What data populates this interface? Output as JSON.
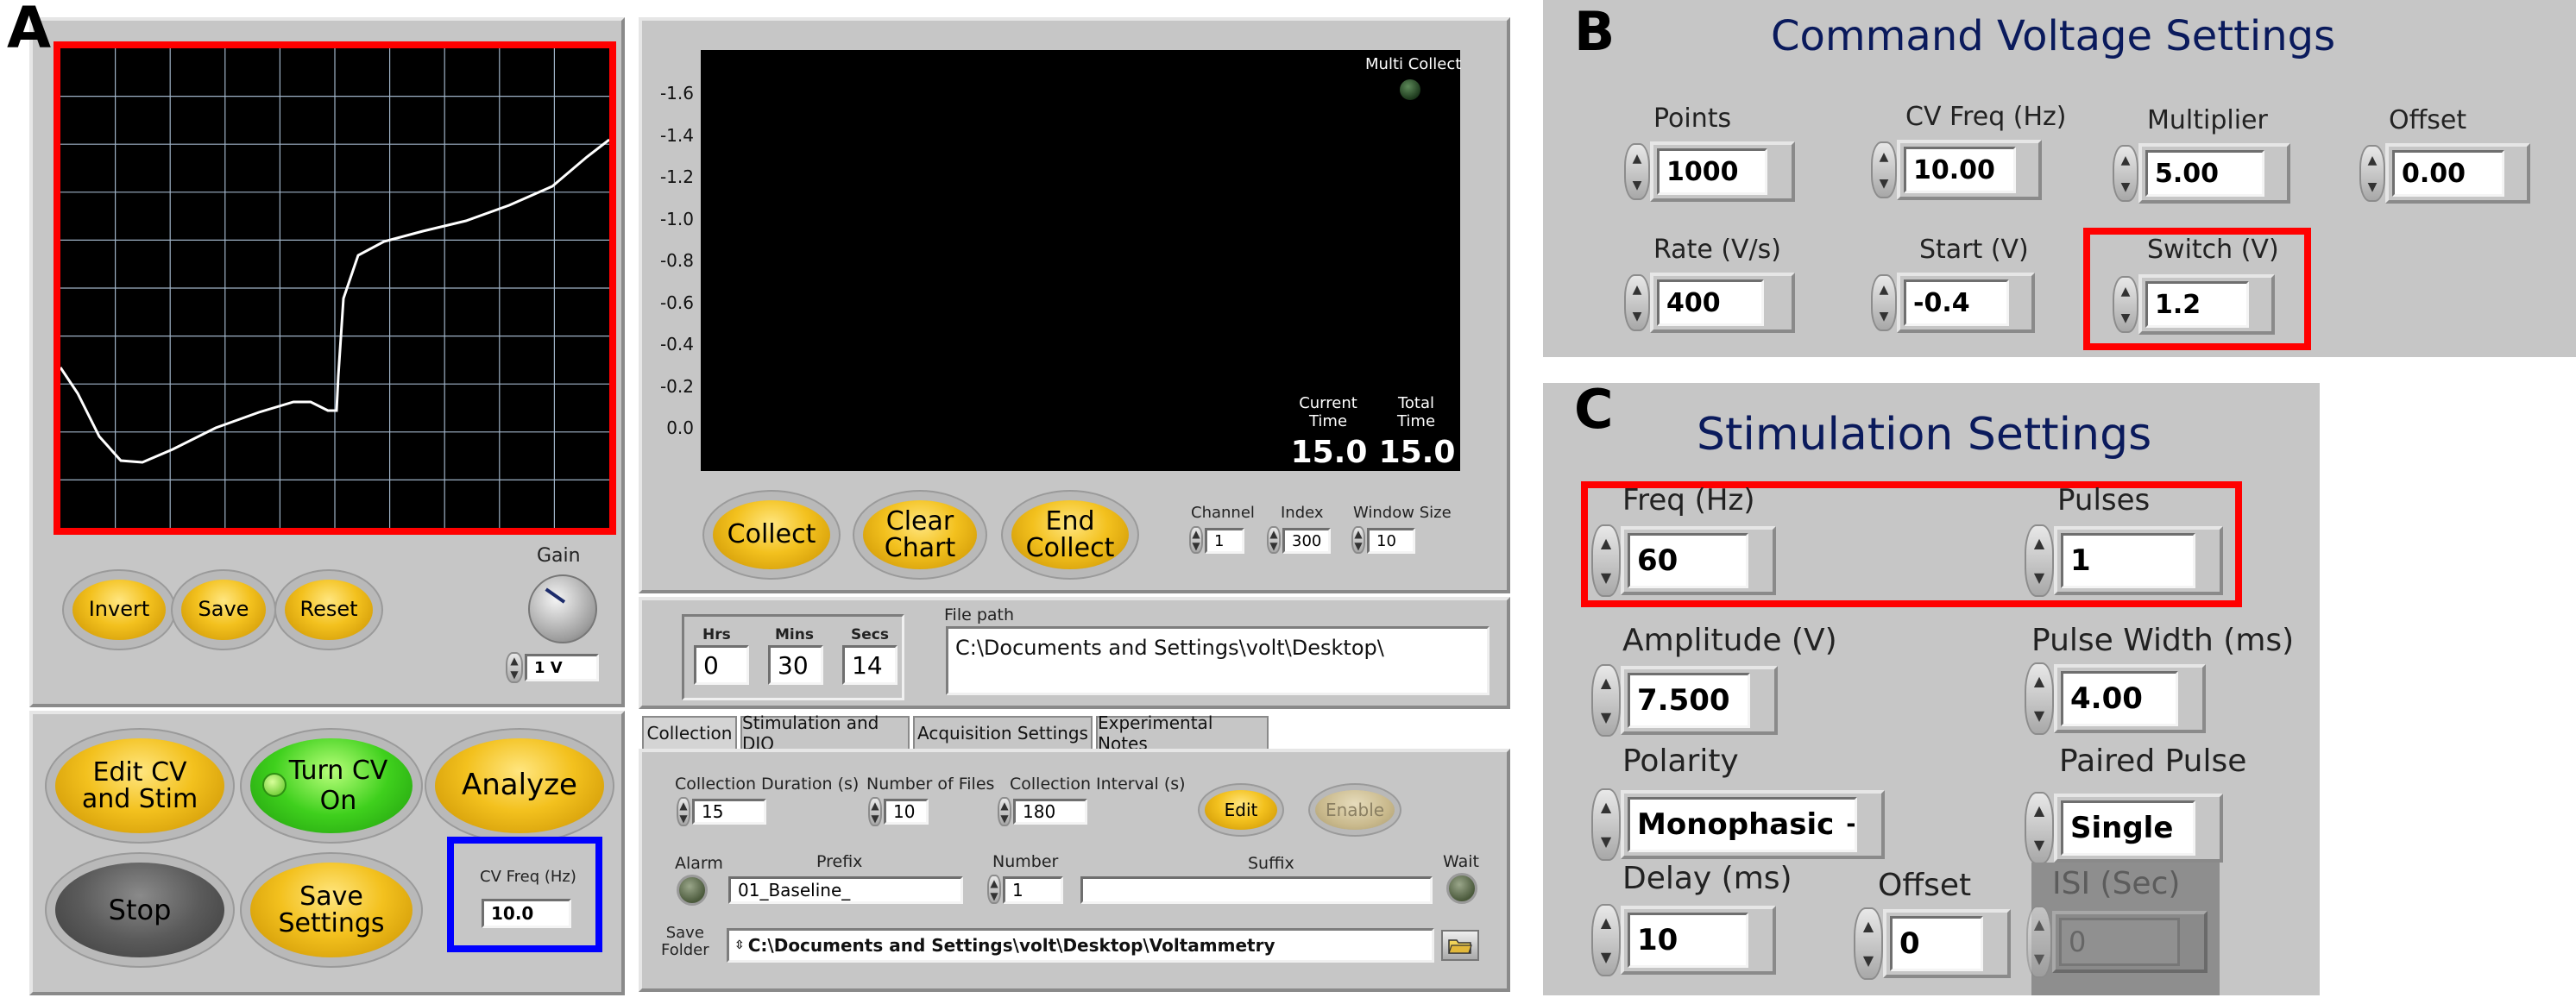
{
  "panel_labels": {
    "a": "A",
    "b": "B",
    "c": "C"
  },
  "colors": {
    "highlight_red": "#ff0000",
    "highlight_blue": "#0000ff",
    "title_navy": "#0a1a5c",
    "button_yellow": "#f3c11e",
    "button_green": "#3fd01d"
  },
  "cv_plot": {
    "trace_color": "#ffffff"
  },
  "cv_buttons": {
    "invert": "Invert",
    "save": "Save",
    "reset": "Reset"
  },
  "gain": {
    "label": "Gain",
    "value": "1 V"
  },
  "main_buttons": {
    "edit_cv_stim": "Edit CV\nand Stim",
    "turn_cv_on": "Turn CV\nOn",
    "analyze": "Analyze",
    "stop": "Stop",
    "save_settings": "Save\nSettings"
  },
  "cv_freq_box": {
    "label": "CV Freq (Hz)",
    "value": "10.0"
  },
  "chart": {
    "y_ticks": [
      "-1.6",
      "-1.4",
      "-1.2",
      "-1.0",
      "-0.8",
      "-0.6",
      "-0.4",
      "-0.2",
      "0.0"
    ],
    "multi_collect_label": "Multi Collect",
    "current_time_label": "Current\nTime",
    "current_time_value": "15.0",
    "total_time_label": "Total\nTime",
    "total_time_value": "15.0"
  },
  "collect_buttons": {
    "collect": "Collect",
    "clear_chart": "Clear\nChart",
    "end_collect": "End\nCollect"
  },
  "collect_params": {
    "channel_label": "Channel",
    "channel_value": "1",
    "index_label": "Index",
    "index_value": "300",
    "window_label": "Window Size",
    "window_value": "10"
  },
  "timer": {
    "hrs_label": "Hrs",
    "hrs_value": "0",
    "mins_label": "Mins",
    "mins_value": "30",
    "secs_label": "Secs",
    "secs_value": "14"
  },
  "file_path": {
    "label": "File path",
    "value": "C:\\Documents and Settings\\volt\\Desktop\\"
  },
  "tabs": [
    "Collection",
    "Stimulation and DIO",
    "Acquisition Settings",
    "Experimental Notes"
  ],
  "collection_tab": {
    "duration_label": "Collection Duration (s)",
    "duration_value": "15",
    "num_files_label": "Number of Files",
    "num_files_value": "10",
    "interval_label": "Collection Interval (s)",
    "interval_value": "180",
    "edit": "Edit",
    "enable": "Enable",
    "alarm_label": "Alarm",
    "prefix_label": "Prefix",
    "prefix_value": "01_Baseline_",
    "number_label": "Number",
    "number_value": "1",
    "suffix_label": "Suffix",
    "suffix_value": "",
    "wait_label": "Wait",
    "save_folder_label": "Save\nFolder",
    "save_folder_value": "C:\\Documents and Settings\\volt\\Desktop\\Voltammetry"
  },
  "command_voltage": {
    "title": "Command Voltage Settings",
    "points_label": "Points",
    "points_value": "1000",
    "cv_freq_label": "CV Freq (Hz)",
    "cv_freq_value": "10.00",
    "multiplier_label": "Multiplier",
    "multiplier_value": "5.00",
    "offset_label": "Offset",
    "offset_value": "0.00",
    "rate_label": "Rate (V/s)",
    "rate_value": "400",
    "start_label": "Start (V)",
    "start_value": "-0.4",
    "switch_label": "Switch (V)",
    "switch_value": "1.2"
  },
  "stimulation": {
    "title": "Stimulation Settings",
    "freq_label": "Freq (Hz)",
    "freq_value": "60",
    "pulses_label": "Pulses",
    "pulses_value": "1",
    "amplitude_label": "Amplitude (V)",
    "amplitude_value": "7.500",
    "pulse_width_label": "Pulse Width (ms)",
    "pulse_width_value": "4.00",
    "polarity_label": "Polarity",
    "polarity_value": "Monophasic +",
    "paired_pulse_label": "Paired Pulse",
    "paired_pulse_value": "Single",
    "delay_label": "Delay (ms)",
    "delay_value": "10",
    "offset_label": "Offset",
    "offset_value": "0",
    "isi_label": "ISI (Sec)",
    "isi_value": "0"
  }
}
